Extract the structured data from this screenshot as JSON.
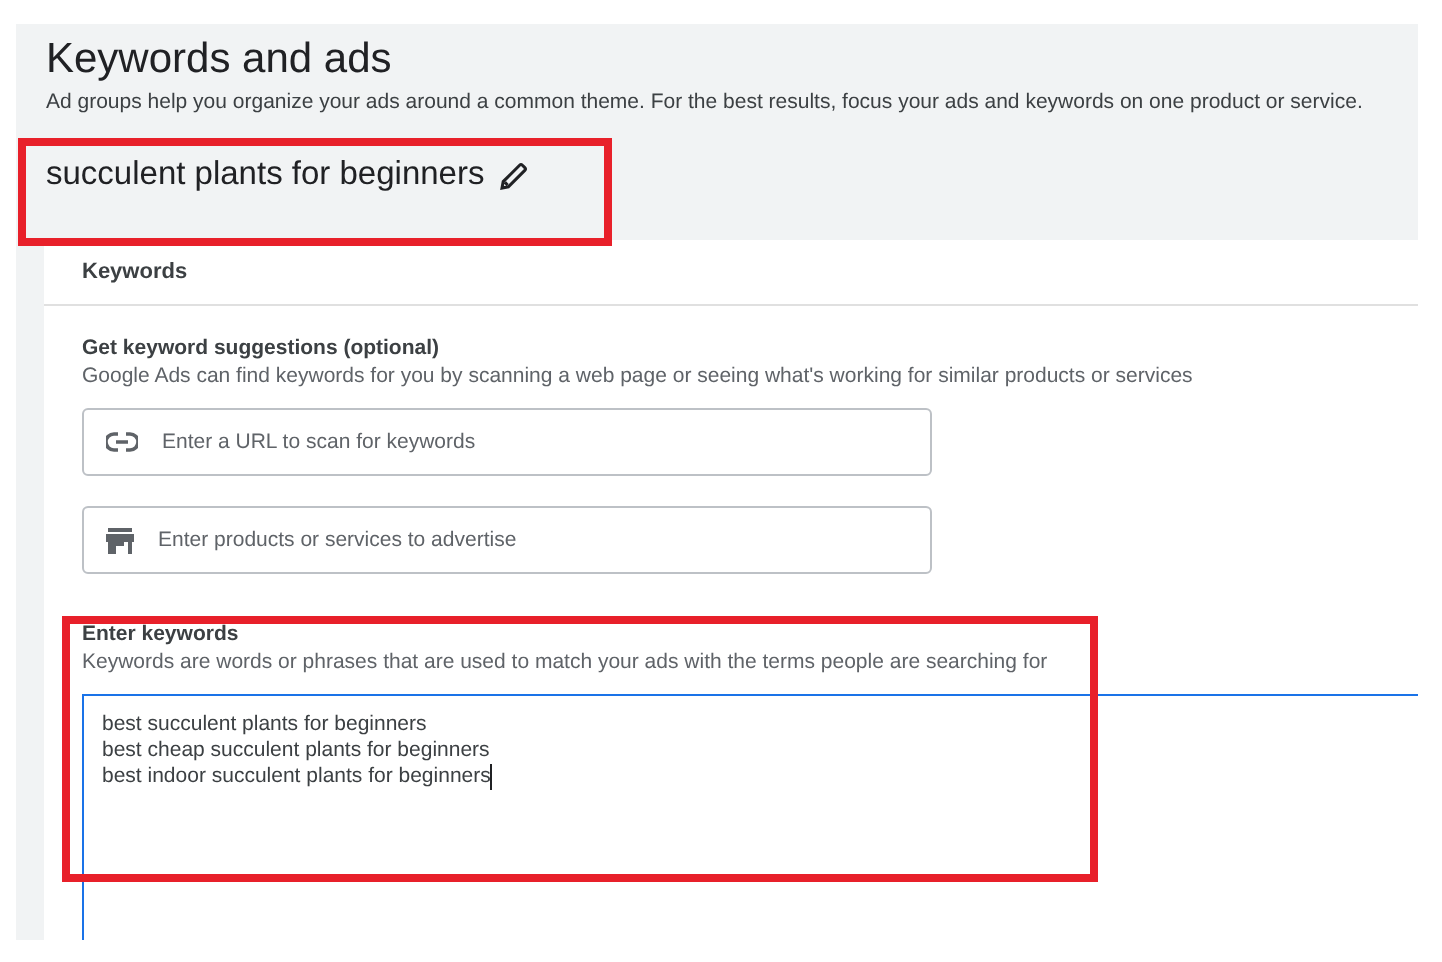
{
  "header": {
    "title": "Keywords and ads",
    "subtitle": "Ad groups help you organize your ads around a common theme. For the best results, focus your ads and keywords on one product or service."
  },
  "ad_group": {
    "name": "succulent plants for beginners",
    "highlighted": true
  },
  "card": {
    "title": "Keywords",
    "suggestions": {
      "heading": "Get keyword suggestions (optional)",
      "description": "Google Ads can find keywords for you by scanning a web page or seeing what's working for similar products or services",
      "fields": [
        {
          "kind": "link",
          "placeholder": "Enter a URL to scan for keywords"
        },
        {
          "kind": "store",
          "placeholder": "Enter products or services to advertise"
        }
      ]
    },
    "keywords": {
      "heading": "Enter keywords",
      "description": "Keywords are words or phrases that are used to match your ads with the terms people are searching for",
      "lines": [
        "best succulent plants for beginners",
        "best cheap succulent plants for beginners",
        "best indoor succulent plants for beginners"
      ],
      "focused": true,
      "highlighted": true
    }
  }
}
